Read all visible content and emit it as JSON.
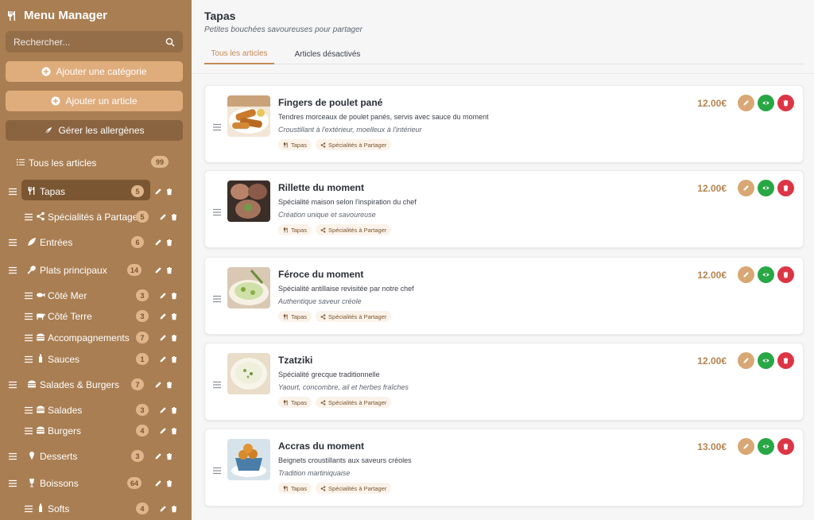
{
  "sidebar": {
    "title": "Menu Manager",
    "search_placeholder": "Rechercher...",
    "buttons": {
      "add_category": "Ajouter une catégorie",
      "add_item": "Ajouter un article",
      "allergens": "Gérer les allergènes"
    },
    "all_items": {
      "label": "Tous les articles",
      "count": "99"
    },
    "categories": [
      {
        "label": "Tapas",
        "count": "5",
        "icon": "utensils-icon",
        "active": true
      },
      {
        "label": "Spécialités à Partager",
        "count": "5",
        "icon": "share-icon",
        "sub": true
      },
      {
        "label": "Entrées",
        "count": "6",
        "icon": "leaf-icon"
      },
      {
        "label": "Plats principaux",
        "count": "14",
        "icon": "drumstick-icon"
      },
      {
        "label": "Côté Mer",
        "count": "3",
        "icon": "fish-icon",
        "sub": true
      },
      {
        "label": "Côté Terre",
        "count": "3",
        "icon": "cow-icon",
        "sub": true
      },
      {
        "label": "Accompagnements",
        "count": "7",
        "icon": "burger-icon",
        "sub": true
      },
      {
        "label": "Sauces",
        "count": "1",
        "icon": "bottle-icon",
        "sub": true
      },
      {
        "label": "Salades & Burgers",
        "count": "7",
        "icon": "burger-icon"
      },
      {
        "label": "Salades",
        "count": "3",
        "icon": "burger-icon",
        "sub": true
      },
      {
        "label": "Burgers",
        "count": "4",
        "icon": "burger-icon",
        "sub": true
      },
      {
        "label": "Desserts",
        "count": "3",
        "icon": "icecream-icon"
      },
      {
        "label": "Boissons",
        "count": "64",
        "icon": "glass-icon"
      },
      {
        "label": "Softs",
        "count": "4",
        "icon": "bottle-icon",
        "sub": true
      }
    ]
  },
  "main": {
    "title": "Tapas",
    "subtitle": "Petites bouchées savoureuses pour partager",
    "tabs": [
      {
        "label": "Tous les articles",
        "active": true
      },
      {
        "label": "Articles désactivés"
      }
    ],
    "items": [
      {
        "name": "Fingers de poulet pané",
        "desc": "Tendres morceaux de poulet panés, servis avec sauce du moment",
        "note": "Croustillant à l'extérieur, moelleux à l'intérieur",
        "price": "12.00€",
        "tags": [
          "Tapas",
          "Spécialités à Partager"
        ]
      },
      {
        "name": "Rillette du moment",
        "desc": "Spécialité maison selon l'inspiration du chef",
        "note": "Création unique et savoureuse",
        "price": "12.00€",
        "tags": [
          "Tapas",
          "Spécialités à Partager"
        ]
      },
      {
        "name": "Féroce du moment",
        "desc": "Spécialité antillaise revisitée par notre chef",
        "note": "Authentique saveur créole",
        "price": "12.00€",
        "tags": [
          "Tapas",
          "Spécialités à Partager"
        ]
      },
      {
        "name": "Tzatziki",
        "desc": "Spécialité grecque traditionnelle",
        "note": "Yaourt, concombre, ail et herbes fraîches",
        "price": "12.00€",
        "tags": [
          "Tapas",
          "Spécialités à Partager"
        ]
      },
      {
        "name": "Accras du moment",
        "desc": "Beignets croustillants aux saveurs créoles",
        "note": "Tradition martiniquaise",
        "price": "13.00€",
        "tags": [
          "Tapas",
          "Spécialités à Partager"
        ]
      }
    ]
  },
  "colors": {
    "sidebar": "#a97e52",
    "accent": "#c58a52",
    "price": "#b5834f",
    "edit": "#d9a774",
    "view": "#28a745",
    "delete": "#dc3545"
  }
}
